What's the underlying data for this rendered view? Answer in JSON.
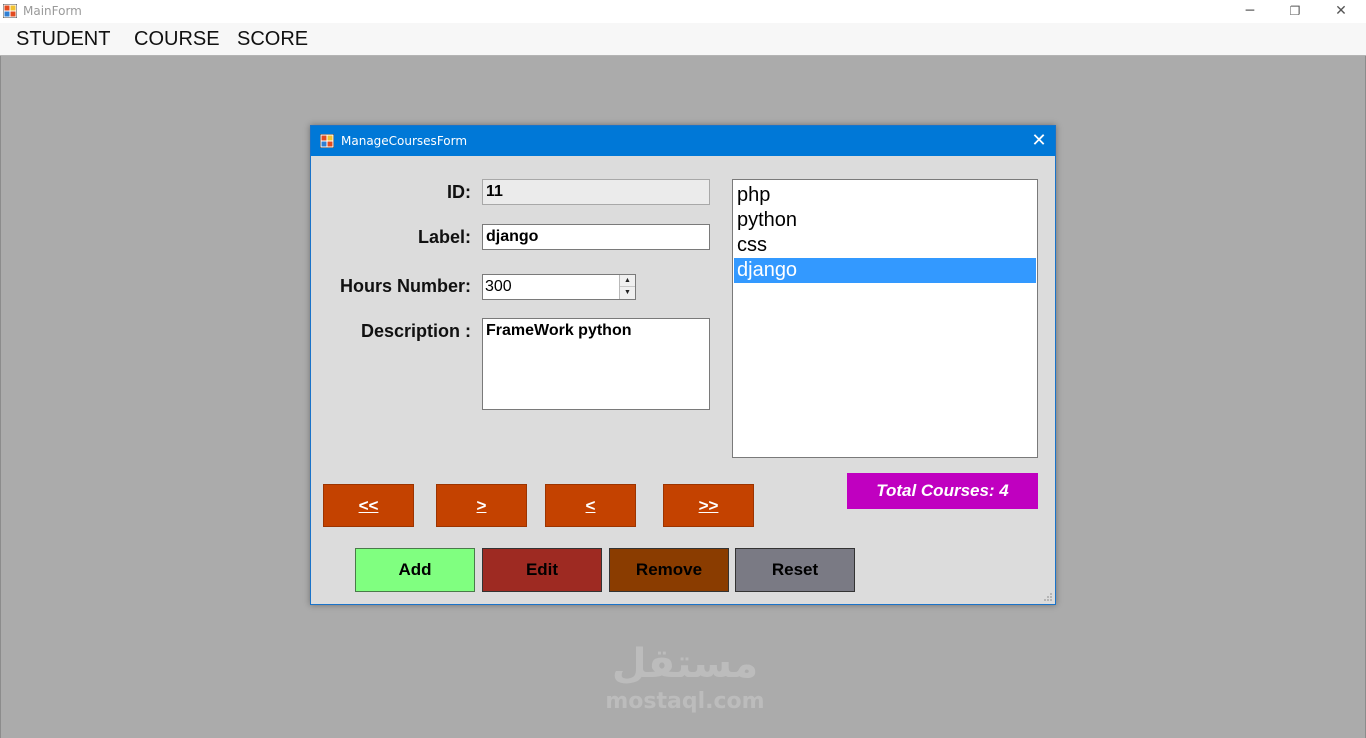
{
  "main": {
    "title": "MainForm",
    "menu": [
      "STUDENT",
      "COURSE",
      "SCORE"
    ]
  },
  "child": {
    "title": "ManageCoursesForm",
    "labels": {
      "id": "ID:",
      "label": "Label:",
      "hours": "Hours Number:",
      "description": "Description :"
    },
    "fields": {
      "id": "11",
      "label": "django",
      "hours": "300",
      "description": "FrameWork python"
    },
    "courses": [
      "php",
      "python",
      "css",
      "django"
    ],
    "selected_course": "django",
    "total": "Total Courses: 4",
    "nav": {
      "first": "<<",
      "next": ">",
      "prev": "<",
      "last": ">>"
    },
    "actions": {
      "add": "Add",
      "edit": "Edit",
      "remove": "Remove",
      "reset": "Reset"
    }
  },
  "watermark": {
    "arabic": "مستقل",
    "latin": "mostaql.com"
  },
  "colors": {
    "titlebar_active": "#0078d7",
    "mdi_background": "#ababab",
    "nav_button": "#c44200",
    "add_button": "#80ff80",
    "edit_button": "#9e2a22",
    "remove_button": "#8a3c00",
    "reset_button": "#7a7a84",
    "total_badge": "#c000c0",
    "list_selection": "#3399ff"
  }
}
